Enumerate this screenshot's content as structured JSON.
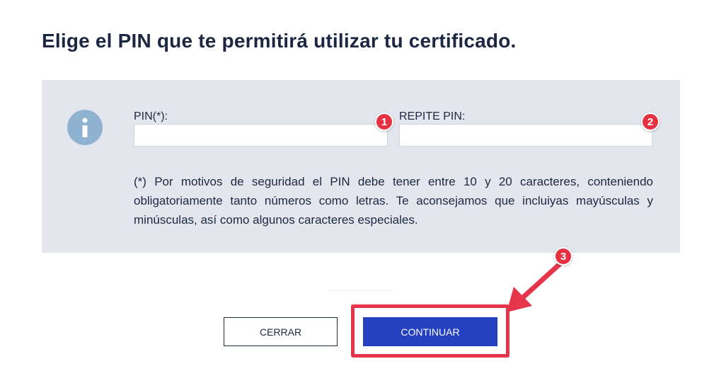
{
  "page_title": "Elige el PIN que te permitirá utilizar tu certificado.",
  "form": {
    "pin_label": "PIN(*):",
    "pin_value": "",
    "repeat_pin_label": "REPITE PIN:",
    "repeat_pin_value": "",
    "note": "(*) Por motivos de seguridad el PIN debe tener entre 10 y 20 caracteres, conteniendo obligatoriamente tanto números como letras. Te aconsejamos que incluiyas mayúsculas y minúsculas, así como algunos caracteres especiales."
  },
  "icons": {
    "info": "info-icon"
  },
  "buttons": {
    "close_label": "CERRAR",
    "continue_label": "CONTINUAR"
  },
  "annotations": {
    "callout_1": "1",
    "callout_2": "2",
    "callout_3": "3"
  },
  "colors": {
    "title_text": "#1c2741",
    "panel_bg": "#e3e7ed",
    "info_icon_bg": "#8fb2d1",
    "primary_button": "#2441c2",
    "annotation_red": "#e5354b"
  }
}
